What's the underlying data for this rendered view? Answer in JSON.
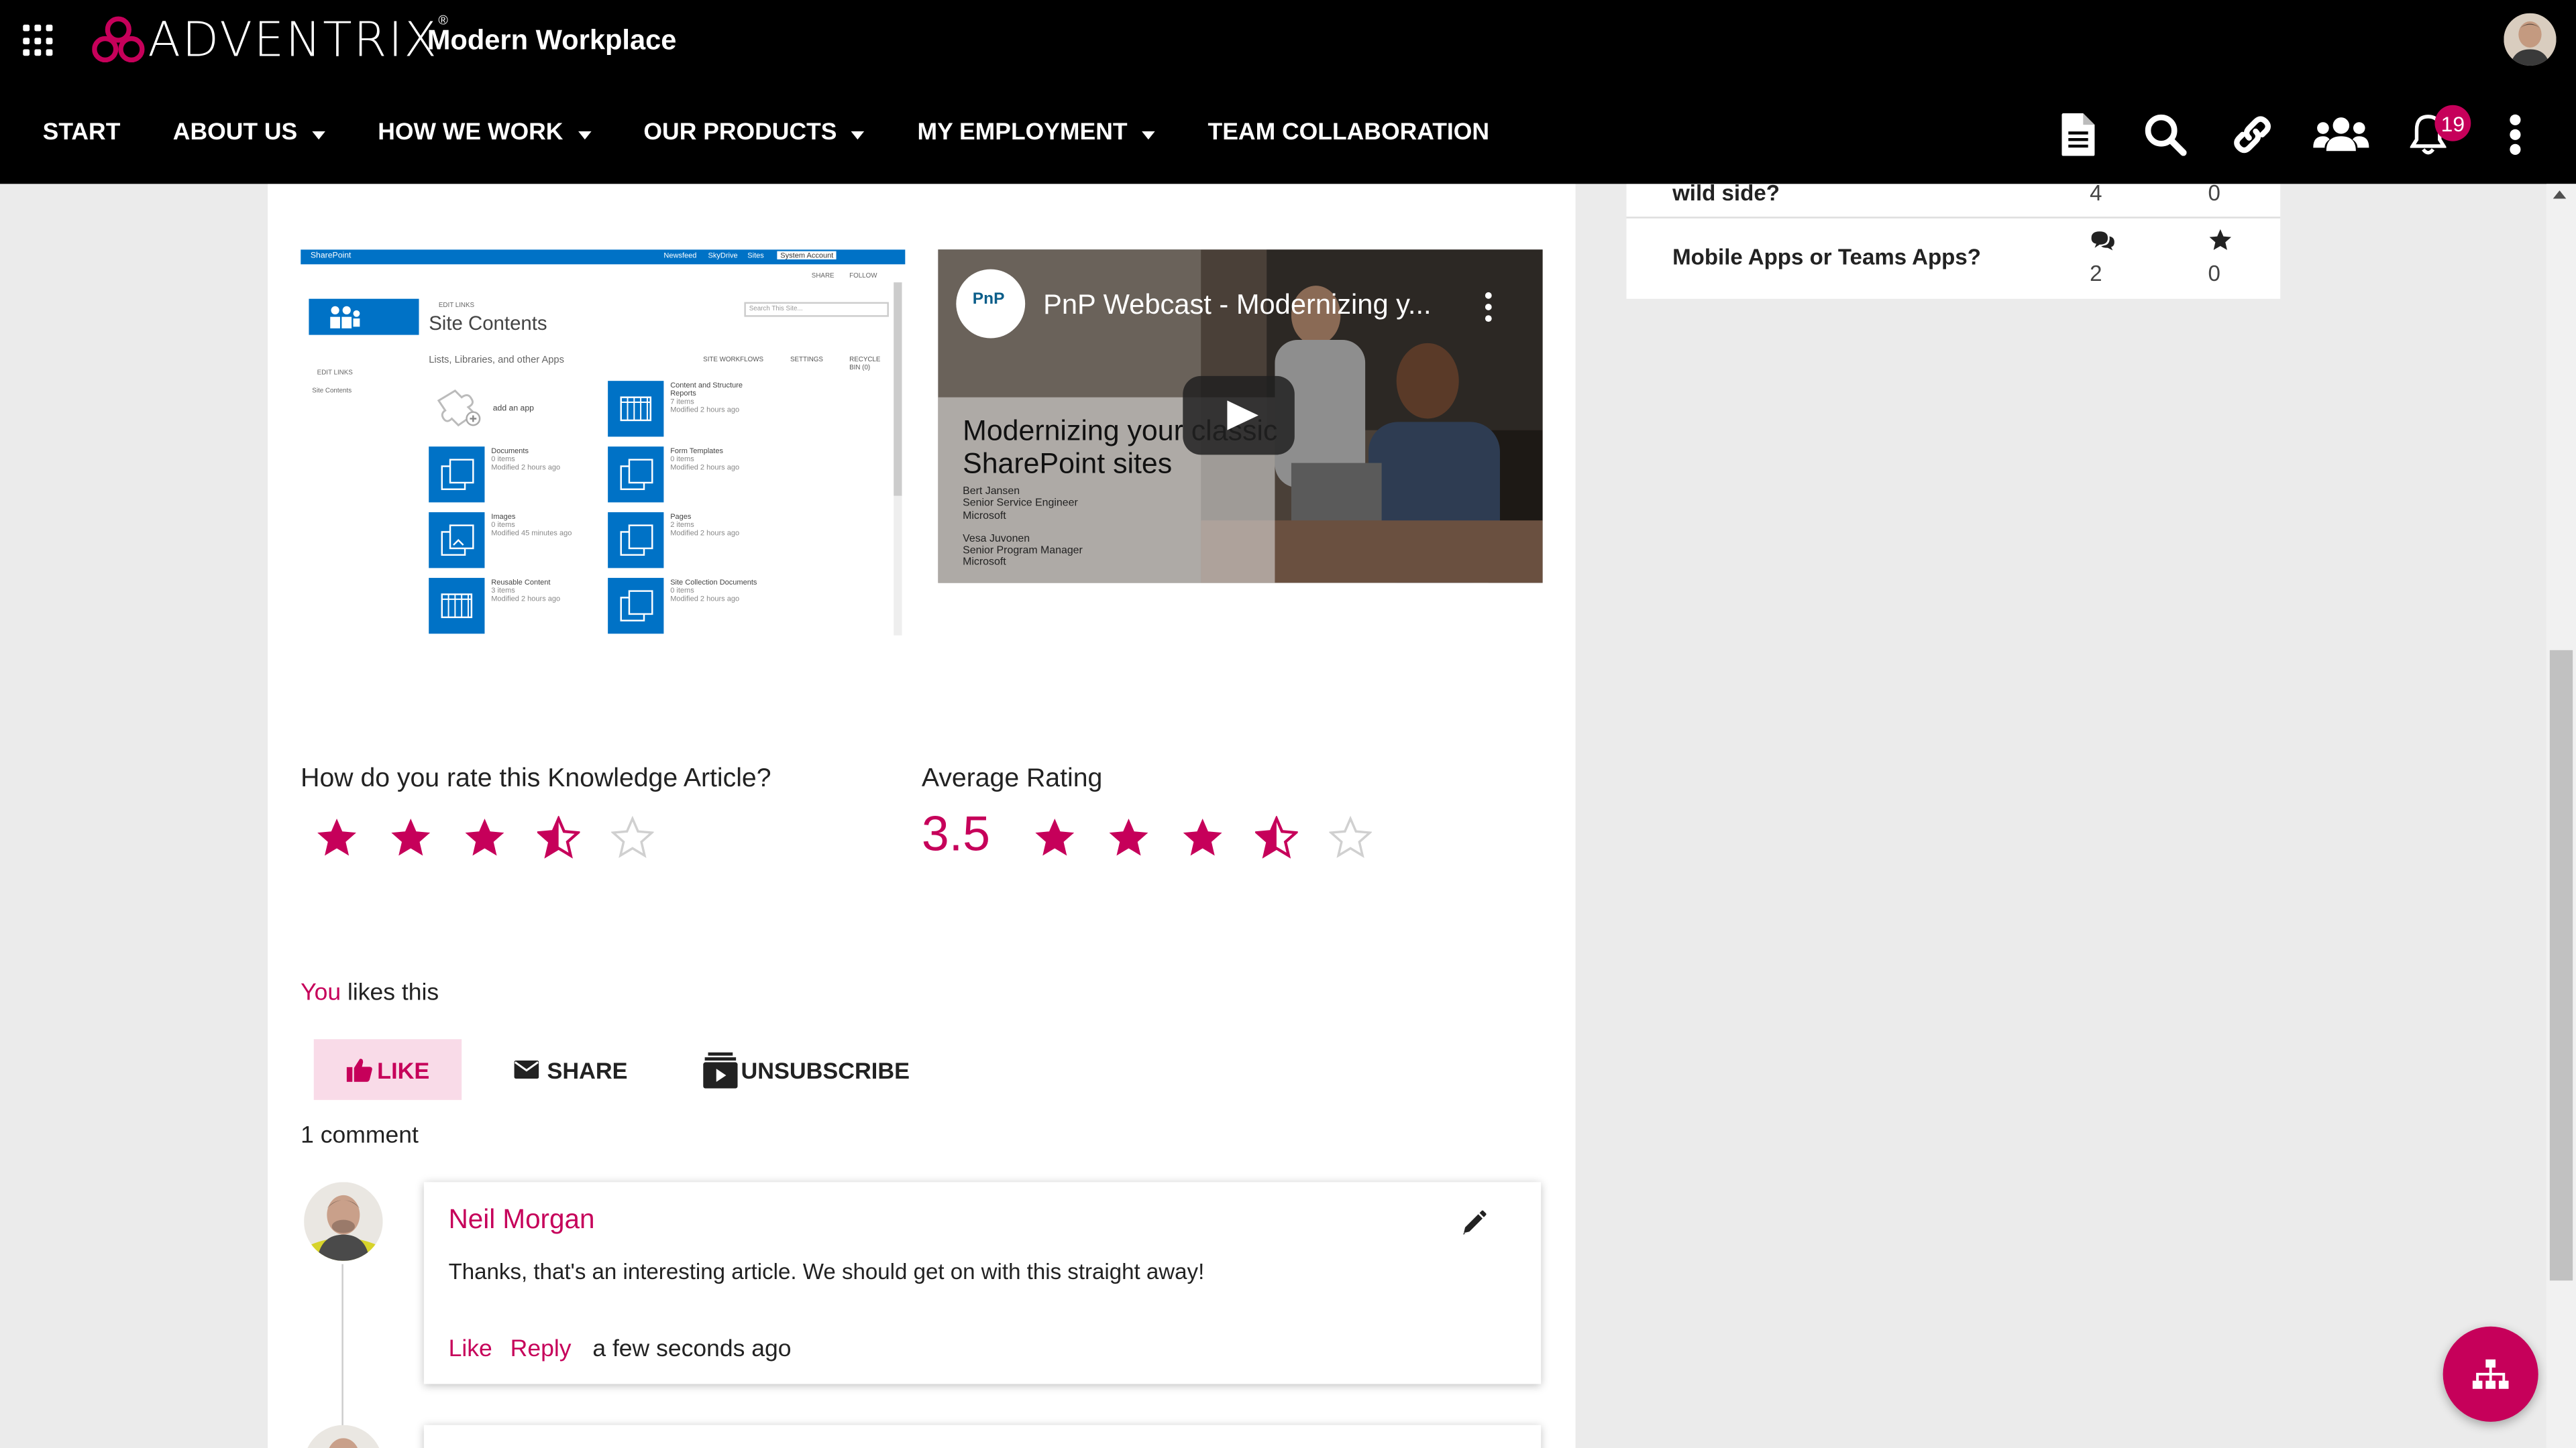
{
  "header": {
    "logo_text": "ADVENTRIX",
    "logo_reg": "®",
    "site_title": "Modern Workplace"
  },
  "nav": {
    "items": [
      {
        "label": "START",
        "has_dropdown": false
      },
      {
        "label": "ABOUT US",
        "has_dropdown": true
      },
      {
        "label": "HOW WE WORK",
        "has_dropdown": true
      },
      {
        "label": "OUR PRODUCTS",
        "has_dropdown": true
      },
      {
        "label": "MY EMPLOYMENT",
        "has_dropdown": true
      },
      {
        "label": "TEAM COLLABORATION",
        "has_dropdown": false
      }
    ],
    "icons": [
      "document-icon",
      "search-icon",
      "link-icon",
      "people-icon",
      "bell-icon",
      "more-vertical-icon"
    ],
    "notification_count": "19"
  },
  "sidebar": {
    "rows": [
      {
        "title": "wild side?",
        "comments": "4",
        "favorites": "0"
      },
      {
        "title": "Mobile Apps or Teams Apps?",
        "comments": "2",
        "favorites": "0"
      }
    ]
  },
  "article": {
    "sharepoint_screenshot": {
      "top_bar": "SharePoint",
      "top_links": [
        "Newsfeed",
        "SkyDrive",
        "Sites"
      ],
      "account": "System Account",
      "share": "SHARE",
      "follow": "FOLLOW",
      "title": "Site Contents",
      "edit_links": "EDIT LINKS",
      "search_placeholder": "Search This Site...",
      "section": "Lists, Libraries, and other Apps",
      "site_workflows": "SITE WORKFLOWS",
      "settings": "SETTINGS",
      "recycle": "RECYCLE BIN (0)",
      "left_nav": "Site Contents",
      "add_app": "add an app",
      "tiles": [
        {
          "name": "Content and Structure Reports",
          "count": "7 items",
          "modified": "Modified 2 hours ago"
        },
        {
          "name": "Documents",
          "count": "0 items",
          "modified": "Modified 2 hours ago"
        },
        {
          "name": "Form Templates",
          "count": "0 items",
          "modified": "Modified 2 hours ago"
        },
        {
          "name": "Images",
          "count": "0 items",
          "modified": "Modified 45 minutes ago"
        },
        {
          "name": "Pages",
          "count": "2 items",
          "modified": "Modified 2 hours ago"
        },
        {
          "name": "Reusable Content",
          "count": "3 items",
          "modified": "Modified 2 hours ago"
        },
        {
          "name": "Site Collection Documents",
          "count": "0 items",
          "modified": "Modified 2 hours ago"
        }
      ]
    },
    "video": {
      "channel": "PnP",
      "title": "PnP Webcast - Modernizing y...",
      "headline_line1": "Modernizing your classic",
      "headline_line2": "SharePoint sites",
      "presenters": [
        "Bert Jansen",
        "Senior Service Engineer",
        "Microsoft",
        "",
        "Vesa Juvonen",
        "Senior Program Manager",
        "Microsoft"
      ]
    }
  },
  "rating": {
    "your_label": "How do you rate this Knowledge Article?",
    "your_rating": 3.5,
    "avg_label": "Average Rating",
    "avg_value": "3.5",
    "max": 5
  },
  "social": {
    "likes_you": "You",
    "likes_rest": " likes this",
    "like_label": "LIKE",
    "share_label": "SHARE",
    "unsubscribe_label": "UNSUBSCRIBE",
    "comment_count": "1 comment"
  },
  "comments": [
    {
      "author": "Neil Morgan",
      "text": "Thanks, that's an interesting article. We should get on with this straight away!",
      "like": "Like",
      "reply": "Reply",
      "time": "a few seconds ago"
    }
  ],
  "colors": {
    "accent": "#c6005a",
    "topbar": "#000000",
    "sharepoint_blue": "#0072c6"
  }
}
